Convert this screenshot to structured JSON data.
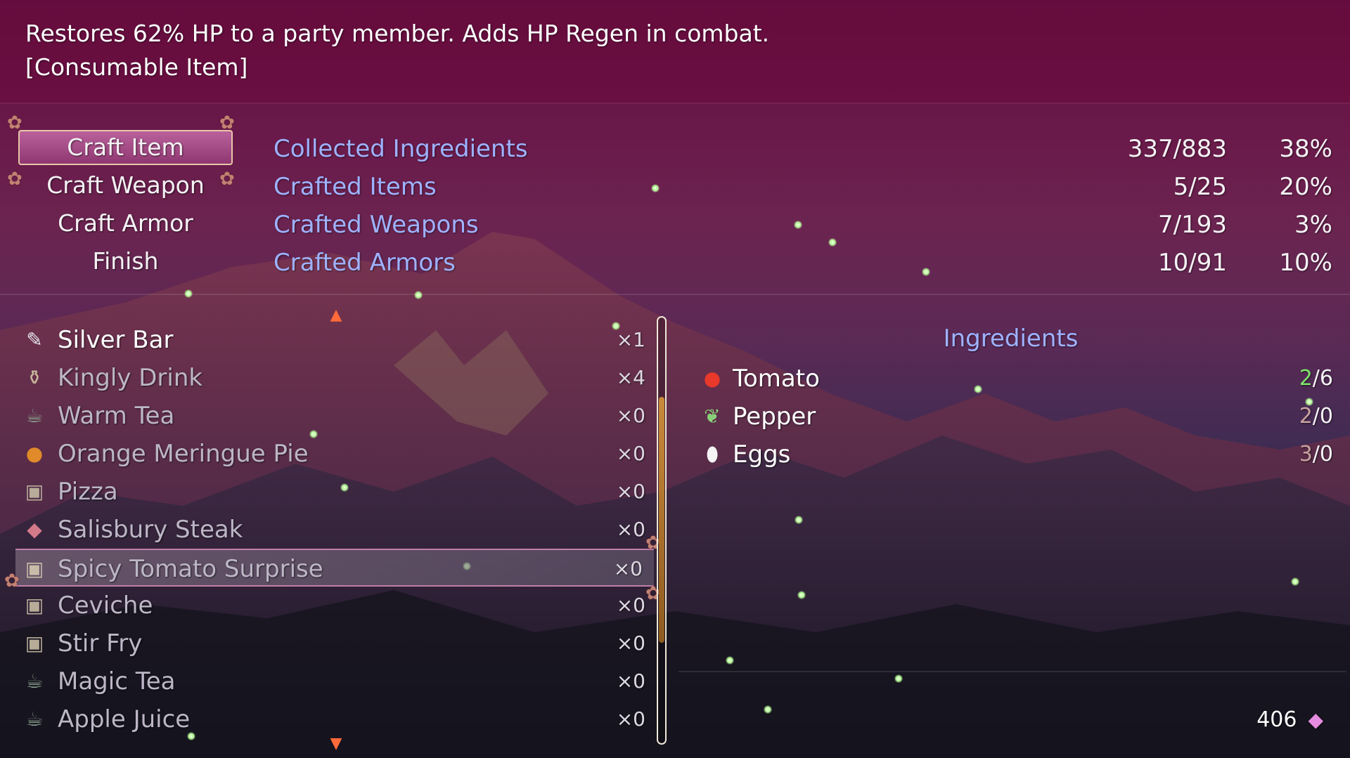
{
  "description": {
    "line1": "Restores 62% HP to a party member. Adds HP Regen in combat.",
    "line2": "[Consumable Item]"
  },
  "menu": {
    "items": [
      {
        "label": "Craft Item",
        "active": true
      },
      {
        "label": "Craft Weapon",
        "active": false
      },
      {
        "label": "Craft Armor",
        "active": false
      },
      {
        "label": "Finish",
        "active": false
      }
    ]
  },
  "stats": [
    {
      "label": "Collected Ingredients",
      "count": "337/883",
      "percent": "38%"
    },
    {
      "label": "Crafted Items",
      "count": "5/25",
      "percent": "20%"
    },
    {
      "label": "Crafted Weapons",
      "count": "7/193",
      "percent": "3%"
    },
    {
      "label": "Crafted Armors",
      "count": "10/91",
      "percent": "10%"
    }
  ],
  "item_list": {
    "items": [
      {
        "name": "Silver Bar",
        "qty": "×1",
        "icon": "silver-bar-icon"
      },
      {
        "name": "Kingly Drink",
        "qty": "×4",
        "icon": "potion-icon"
      },
      {
        "name": "Warm Tea",
        "qty": "×0",
        "icon": "teapot-icon"
      },
      {
        "name": "Orange Meringue Pie",
        "qty": "×0",
        "icon": "pie-icon"
      },
      {
        "name": "Pizza",
        "qty": "×0",
        "icon": "food-box-icon"
      },
      {
        "name": "Salisbury Steak",
        "qty": "×0",
        "icon": "steak-icon"
      },
      {
        "name": "Spicy Tomato Surprise",
        "qty": "×0",
        "icon": "food-box-icon",
        "selected": true
      },
      {
        "name": "Ceviche",
        "qty": "×0",
        "icon": "food-box-icon"
      },
      {
        "name": "Stir Fry",
        "qty": "×0",
        "icon": "food-box-icon"
      },
      {
        "name": "Magic Tea",
        "qty": "×0",
        "icon": "teapot-icon"
      },
      {
        "name": "Apple Juice",
        "qty": "×0",
        "icon": "teapot-icon"
      }
    ],
    "scroll_position": 0.45
  },
  "ingredients": {
    "title": "Ingredients",
    "items": [
      {
        "name": "Tomato",
        "have": "2",
        "need": "/6",
        "have_color": "#7fe36a",
        "icon": "tomato-icon"
      },
      {
        "name": "Pepper",
        "have": "2",
        "need": "/0",
        "have_color": "#c9a0a0",
        "icon": "pepper-icon"
      },
      {
        "name": "Eggs",
        "have": "3",
        "need": "/0",
        "have_color": "#c9a0a0",
        "icon": "egg-icon"
      }
    ]
  },
  "currency": {
    "amount": "406",
    "icon": "gem-icon"
  },
  "colors": {
    "label_blue": "#9fb2ff",
    "highlight_pink": "#c07fa8",
    "scroll_orange": "#c98a3a"
  }
}
